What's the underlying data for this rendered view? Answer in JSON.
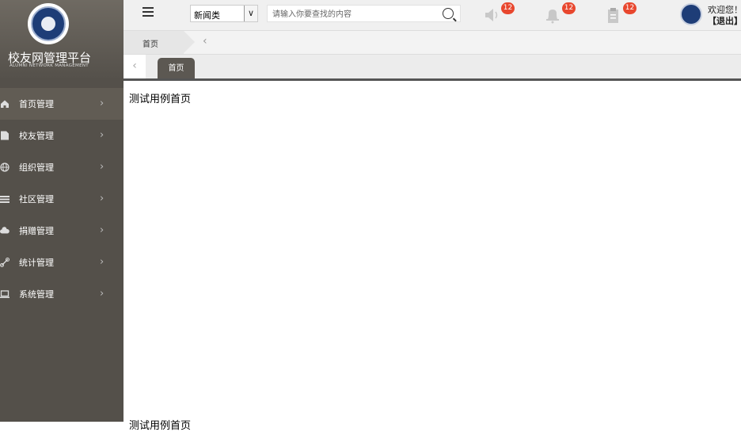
{
  "brand": {
    "title": "校友网管理平台",
    "subtitle": "ALUMNI NETWORK MANAGEMENT",
    "logo": "university-seal"
  },
  "sidebar": {
    "items": [
      {
        "label": "首页管理",
        "icon": "home-icon",
        "active": true
      },
      {
        "label": "校友管理",
        "icon": "document-icon",
        "active": false
      },
      {
        "label": "组织管理",
        "icon": "globe-icon",
        "active": false
      },
      {
        "label": "社区管理",
        "icon": "list-icon",
        "active": false
      },
      {
        "label": "捐赠管理",
        "icon": "cloud-icon",
        "active": false
      },
      {
        "label": "统计管理",
        "icon": "link-icon",
        "active": false
      },
      {
        "label": "系统管理",
        "icon": "laptop-icon",
        "active": false
      }
    ],
    "arrow": "›"
  },
  "topbar": {
    "category_select": {
      "value": "新闻类",
      "button": "∨"
    },
    "search": {
      "placeholder": "请输入你要查找的内容",
      "value": ""
    },
    "notifications": [
      {
        "icon": "speaker-icon",
        "count": "12"
      },
      {
        "icon": "bell-icon",
        "count": "12"
      },
      {
        "icon": "clipboard-icon",
        "count": "12"
      }
    ],
    "user": {
      "welcome": "欢迎您！",
      "logout": "【退出】"
    }
  },
  "breadcrumb": {
    "home": "首页",
    "back": "‹"
  },
  "tabs": {
    "prev": "‹",
    "items": [
      {
        "label": "首页",
        "active": true
      }
    ]
  },
  "content": {
    "title": "测试用例首页",
    "footer": "测试用例首页"
  },
  "colors": {
    "sidebar": "#54504a",
    "tab_active": "#5c5852",
    "badge": "#e8472e"
  }
}
